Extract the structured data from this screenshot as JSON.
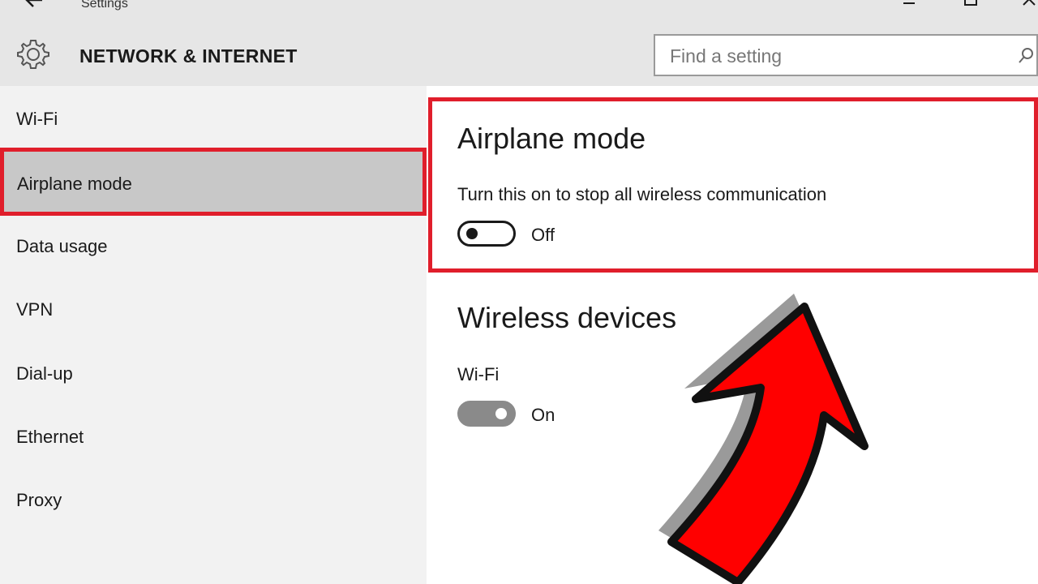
{
  "window": {
    "title": "Settings"
  },
  "header": {
    "section_title": "NETWORK & INTERNET",
    "search_placeholder": "Find a setting"
  },
  "sidebar": {
    "items": [
      {
        "label": "Wi-Fi",
        "selected": false
      },
      {
        "label": "Airplane mode",
        "selected": true
      },
      {
        "label": "Data usage",
        "selected": false
      },
      {
        "label": "VPN",
        "selected": false
      },
      {
        "label": "Dial-up",
        "selected": false
      },
      {
        "label": "Ethernet",
        "selected": false
      },
      {
        "label": "Proxy",
        "selected": false
      }
    ]
  },
  "main": {
    "airplane": {
      "title": "Airplane mode",
      "description": "Turn this on to stop all wireless communication",
      "toggle_state": "Off"
    },
    "wireless": {
      "title": "Wireless devices",
      "wifi_label": "Wi-Fi",
      "toggle_state": "On"
    }
  },
  "colors": {
    "highlight": "#e01e2b",
    "arrow_fill": "#ff0000",
    "selected_bg": "#c8c8c8",
    "header_bg": "#e6e6e6",
    "sidebar_bg": "#f2f2f2"
  },
  "icons": [
    "back-arrow-icon",
    "minimize-icon",
    "maximize-icon",
    "close-icon",
    "gear-icon",
    "search-icon",
    "red-arrow-annotation"
  ]
}
